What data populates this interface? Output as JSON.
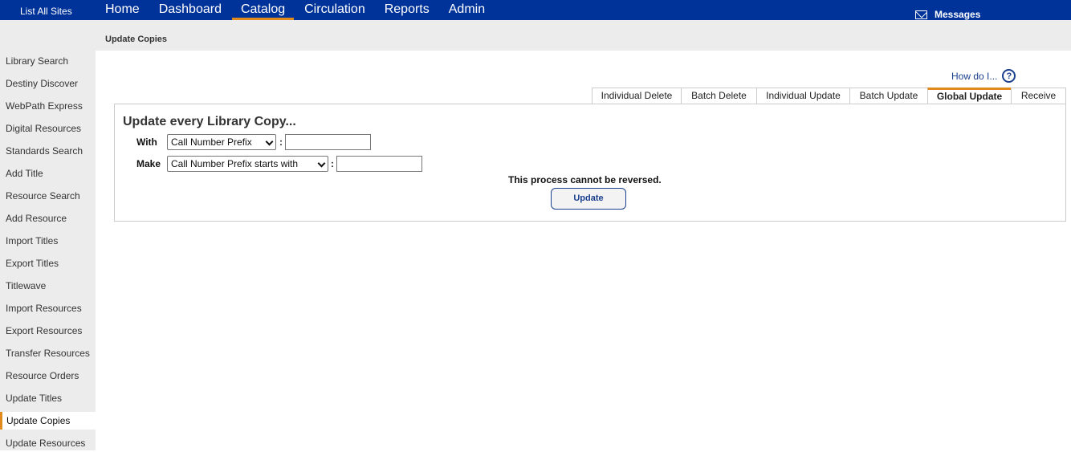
{
  "topbar": {
    "list_sites": "List All Sites",
    "nav": [
      "Home",
      "Dashboard",
      "Catalog",
      "Circulation",
      "Reports",
      "Admin"
    ],
    "active_nav": "Catalog",
    "messages": "Messages"
  },
  "breadcrumb": "Update Copies",
  "sidebar": {
    "items": [
      "Library Search",
      "Destiny Discover",
      "WebPath Express",
      "Digital Resources",
      "Standards Search",
      "Add Title",
      "Resource Search",
      "Add Resource",
      "Import Titles",
      "Export Titles",
      "Titlewave",
      "Import Resources",
      "Export Resources",
      "Transfer Resources",
      "Resource Orders",
      "Update Titles",
      "Update Copies",
      "Update Resources"
    ],
    "active": "Update Copies"
  },
  "help": {
    "label": "How do I...",
    "icon": "?"
  },
  "tabs": {
    "items": [
      "Individual Delete",
      "Batch Delete",
      "Individual Update",
      "Batch Update",
      "Global Update",
      "Receive"
    ],
    "active": "Global Update"
  },
  "form": {
    "title": "Update every Library Copy...",
    "with_label": "With",
    "with_select": "Call Number Prefix",
    "with_value": "",
    "make_label": "Make",
    "make_select": "Call Number Prefix starts with",
    "make_value": "",
    "separator": ":",
    "warning": "This process cannot be reversed.",
    "update_button": "Update"
  },
  "colors": {
    "nav_bg": "#003399",
    "accent": "#e08a1e",
    "panel_border": "#cccccc",
    "link": "#1a3f8f"
  }
}
